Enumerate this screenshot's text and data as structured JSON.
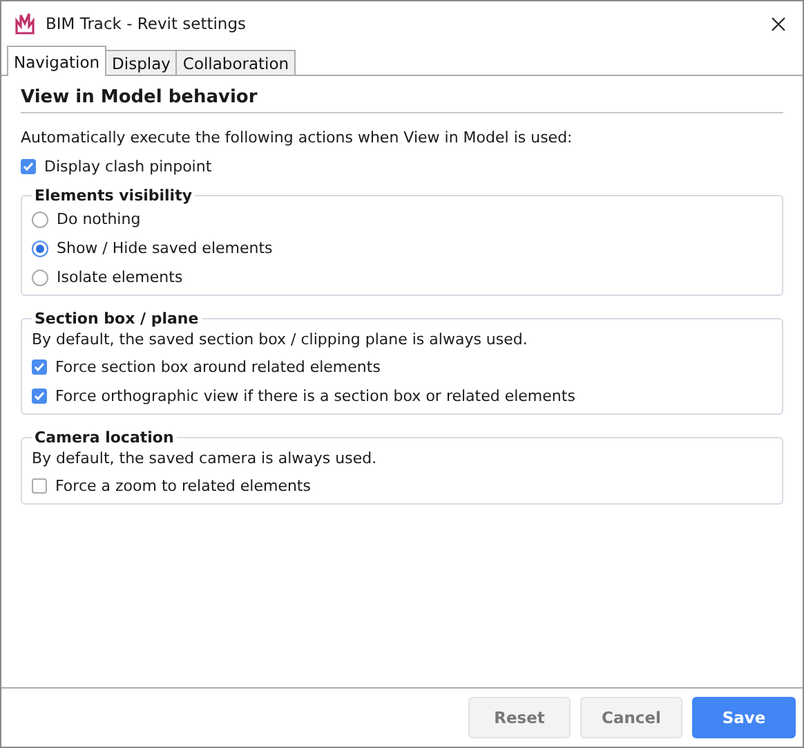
{
  "window": {
    "title": "BIM Track - Revit settings"
  },
  "tabs": [
    {
      "label": "Navigation",
      "selected": true
    },
    {
      "label": "Display",
      "selected": false
    },
    {
      "label": "Collaboration",
      "selected": false
    }
  ],
  "heading": "View in Model behavior",
  "intro": "Automatically execute the following actions when View in Model is used:",
  "top_option": {
    "label": "Display clash pinpoint",
    "checked": true
  },
  "groups": [
    {
      "title": "Elements visibility",
      "items": [
        {
          "kind": "radio",
          "label": "Do nothing",
          "selected": false
        },
        {
          "kind": "radio",
          "label": "Show / Hide saved elements",
          "selected": true
        },
        {
          "kind": "radio",
          "label": "Isolate elements",
          "selected": false
        }
      ]
    },
    {
      "title": "Section box / plane",
      "description": "By default, the saved section box / clipping plane is always used.",
      "items": [
        {
          "kind": "checkbox",
          "label": "Force section box around related elements",
          "checked": true
        },
        {
          "kind": "checkbox",
          "label": "Force orthographic view if there is a section box or related elements",
          "checked": true
        }
      ]
    },
    {
      "title": "Camera location",
      "description": "By default, the saved camera is always used.",
      "items": [
        {
          "kind": "checkbox",
          "label": "Force a zoom to related elements",
          "checked": false
        }
      ]
    }
  ],
  "buttons": [
    {
      "label": "Reset",
      "kind": "secondary",
      "disabled": true
    },
    {
      "label": "Cancel",
      "kind": "secondary",
      "disabled": true
    },
    {
      "label": "Save",
      "kind": "primary",
      "disabled": false
    }
  ]
}
